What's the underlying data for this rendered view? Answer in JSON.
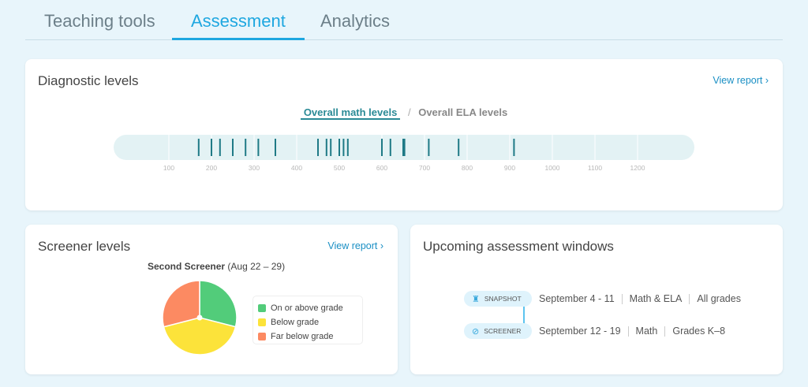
{
  "tabs": [
    {
      "label": "Teaching tools"
    },
    {
      "label": "Assessment",
      "active": true
    },
    {
      "label": "Analytics"
    }
  ],
  "diagnostic": {
    "title": "Diagnostic levels",
    "view_report": "View report ›",
    "toggle": {
      "active": "Overall math levels",
      "separator": "/",
      "inactive": "Overall ELA levels"
    }
  },
  "screener": {
    "title": "Screener levels",
    "view_report": "View report ›",
    "subtitle_bold": "Second Screener",
    "subtitle_dates": "(Aug 22 – 29)"
  },
  "upcoming": {
    "title": "Upcoming assessment windows",
    "rows": [
      {
        "badge": "SNAPSHOT",
        "icon": "castle-icon",
        "dates": "September 4 - 11",
        "subject": "Math & ELA",
        "grades": "All grades"
      },
      {
        "badge": "SCREENER",
        "icon": "compass-icon",
        "dates": "September 12 - 19",
        "subject": "Math",
        "grades": "Grades K–8"
      }
    ]
  },
  "colors": {
    "accent": "#1ea7e0",
    "mark": "#1f7a86",
    "track": "#e3f2f4",
    "green": "#52cc7a",
    "yellow": "#fce33a",
    "orange": "#fc8a62"
  },
  "chart_data": [
    {
      "type": "scatter",
      "xlim": [
        0,
        1300
      ],
      "ticks": [
        100,
        200,
        300,
        400,
        500,
        600,
        700,
        800,
        900,
        1000,
        1100,
        1200
      ],
      "tick_labels": [
        "100",
        "200",
        "300",
        "400",
        "500",
        "600",
        "700",
        "800",
        "900",
        "1000",
        "1100",
        "1200"
      ],
      "values": [
        170,
        200,
        220,
        250,
        280,
        310,
        350,
        450,
        470,
        480,
        500,
        510,
        520,
        600,
        620,
        650,
        653,
        710,
        780,
        910
      ]
    },
    {
      "type": "pie",
      "labels": [
        "On or above grade",
        "Below grade",
        "Far below grade"
      ],
      "values": [
        29,
        42,
        29
      ],
      "colors": [
        "#52cc7a",
        "#fce33a",
        "#fc8a62"
      ]
    }
  ]
}
